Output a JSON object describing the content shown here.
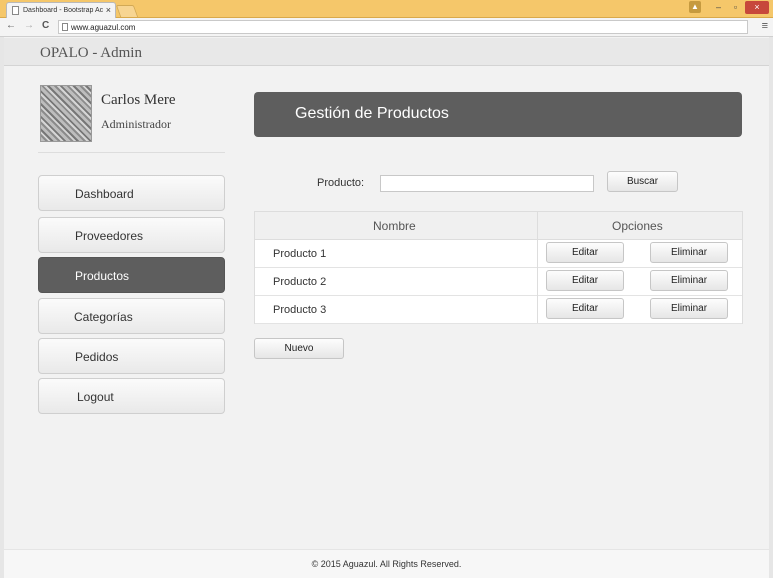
{
  "browser": {
    "tab_title": "Dashboard - Bootstrap Ac",
    "tab_close": "×",
    "url": "www.aguazul.com",
    "back": "←",
    "forward": "→",
    "reload": "C",
    "menu": "≡",
    "user": "▲",
    "minimize": "–",
    "maximize": "▫",
    "close": "×"
  },
  "header": {
    "brand": "OPALO - Admin"
  },
  "user": {
    "name": "Carlos Mere",
    "role": "Administrador"
  },
  "sidebar": {
    "items": [
      {
        "label": "Dashboard"
      },
      {
        "label": "Proveedores"
      },
      {
        "label": "Productos",
        "active": true
      },
      {
        "label": "Categorías"
      },
      {
        "label": "Pedidos"
      },
      {
        "label": "Logout"
      }
    ]
  },
  "main": {
    "title": "Gestión de Productos",
    "search": {
      "label": "Producto:",
      "value": "",
      "placeholder": "",
      "button": "Buscar"
    },
    "table": {
      "headers": [
        "Nombre",
        "Opciones"
      ],
      "rows": [
        {
          "name": "Producto 1",
          "edit": "Editar",
          "delete": "Eliminar"
        },
        {
          "name": "Producto 2",
          "edit": "Editar",
          "delete": "Eliminar"
        },
        {
          "name": "Producto 3",
          "edit": "Editar",
          "delete": "Eliminar"
        }
      ]
    },
    "new_button": "Nuevo"
  },
  "footer": {
    "text": "© 2015 Aguazul. All Rights Reserved."
  },
  "colors": {
    "titlebar": "#f5c76a",
    "panel": "#5e5e5e",
    "close": "#c7483b"
  }
}
